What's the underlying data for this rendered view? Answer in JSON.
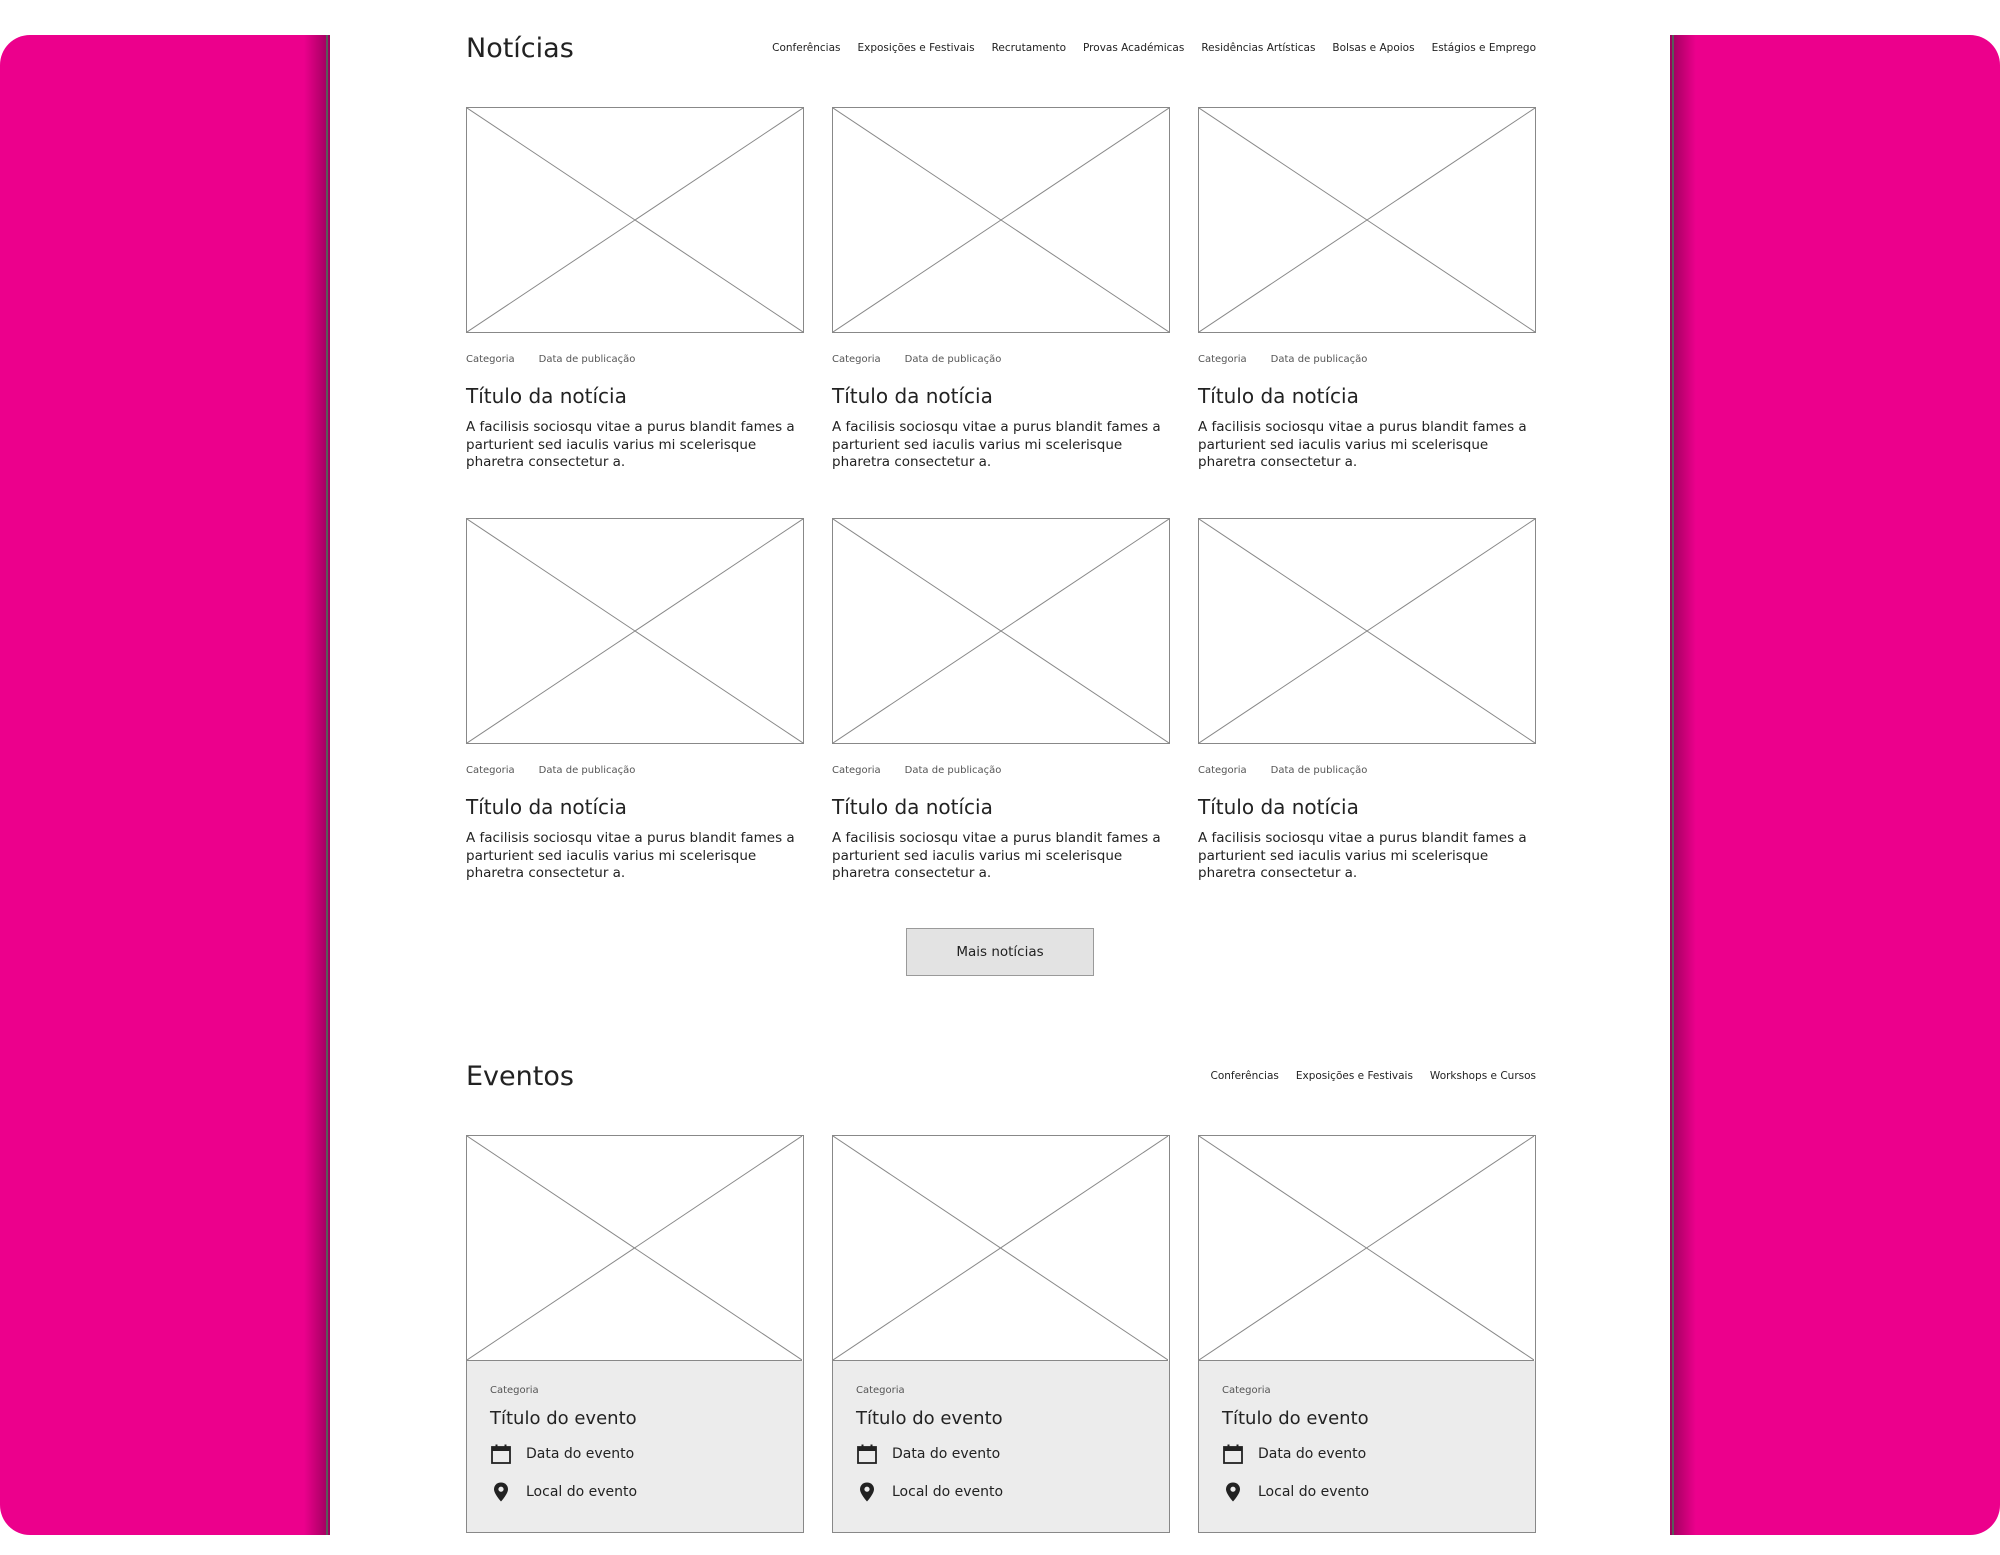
{
  "colors": {
    "side_panels": "#ec008c",
    "placeholder_stroke": "#888888",
    "event_info_bg": "#ececec",
    "button_bg": "#e3e3e3"
  },
  "news": {
    "title": "Notícias",
    "nav": [
      "Conferências",
      "Exposições e Festivais",
      "Recrutamento",
      "Provas Académicas",
      "Residências Artísticas",
      "Bolsas e Apoios",
      "Estágios e Emprego"
    ],
    "cards": [
      {
        "category": "Categoria",
        "date": "Data de publicação",
        "title": "Título da notícia",
        "text": "A facilisis sociosqu vitae a purus blandit fames a parturient sed iaculis varius mi scelerisque pharetra consectetur a."
      },
      {
        "category": "Categoria",
        "date": "Data de publicação",
        "title": "Título da notícia",
        "text": "A facilisis sociosqu vitae a purus blandit fames a parturient sed iaculis varius mi scelerisque pharetra consectetur a."
      },
      {
        "category": "Categoria",
        "date": "Data de publicação",
        "title": "Título da notícia",
        "text": "A facilisis sociosqu vitae a purus blandit fames a parturient sed iaculis varius mi scelerisque pharetra consectetur a."
      },
      {
        "category": "Categoria",
        "date": "Data de publicação",
        "title": "Título da notícia",
        "text": "A facilisis sociosqu vitae a purus blandit fames a parturient sed iaculis varius mi scelerisque pharetra consectetur a."
      },
      {
        "category": "Categoria",
        "date": "Data de publicação",
        "title": "Título da notícia",
        "text": "A facilisis sociosqu vitae a purus blandit fames a parturient sed iaculis varius mi scelerisque pharetra consectetur a."
      },
      {
        "category": "Categoria",
        "date": "Data de publicação",
        "title": "Título da notícia",
        "text": "A facilisis sociosqu vitae a purus blandit fames a parturient sed iaculis varius mi scelerisque pharetra consectetur a."
      }
    ],
    "more_button": "Mais notícias"
  },
  "events": {
    "title": "Eventos",
    "nav": [
      "Conferências",
      "Exposições e Festivais",
      "Workshops e Cursos"
    ],
    "cards": [
      {
        "category": "Categoria",
        "title": "Título do evento",
        "date": "Data do evento",
        "location": "Local do evento",
        "date_icon": "calendar-icon",
        "location_icon": "map-pin-icon"
      },
      {
        "category": "Categoria",
        "title": "Título do evento",
        "date": "Data do evento",
        "location": "Local do evento",
        "date_icon": "calendar-icon",
        "location_icon": "map-pin-icon"
      },
      {
        "category": "Categoria",
        "title": "Título do evento",
        "date": "Data do evento",
        "location": "Local do evento",
        "date_icon": "calendar-icon",
        "location_icon": "map-pin-icon"
      }
    ]
  }
}
